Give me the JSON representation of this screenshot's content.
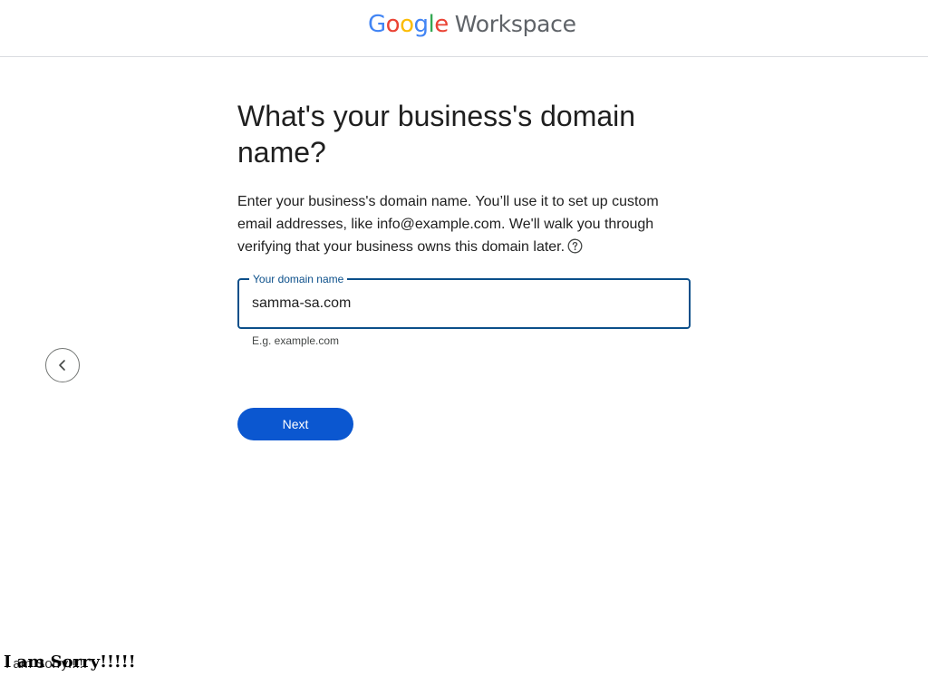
{
  "header": {
    "logo_brand": "Google",
    "logo_product": "Workspace"
  },
  "nav": {
    "back_icon": "chevron-left-icon"
  },
  "main": {
    "title": "What's your business's domain name?",
    "description": "Enter your business's domain name. You’ll use it to set up custom email addresses, like info@example.com. We'll walk you through verifying that your business owns this domain later.",
    "help_icon": "help-circle-icon",
    "domain_field": {
      "label": "Your domain name",
      "value": "samma-sa.com",
      "hint": "E.g. example.com"
    },
    "next_label": "Next"
  },
  "overlay": {
    "text": "I am Sorry!!!!!"
  },
  "colors": {
    "primary_button": "#0b57d0",
    "field_border": "#0b4f8a",
    "google_blue": "#4285f4",
    "google_red": "#ea4335",
    "google_yellow": "#fbbc05",
    "google_green": "#34a853"
  }
}
